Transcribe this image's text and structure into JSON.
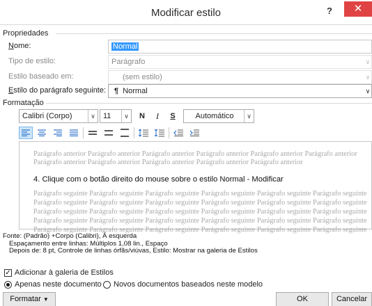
{
  "window": {
    "title": "Modificar estilo",
    "help_label": "?",
    "close_label": "✕"
  },
  "properties": {
    "section_label": "Propriedades",
    "name_label": "Nome:",
    "name_value": "Normal",
    "style_type_label": "Tipo de estilo:",
    "style_type_value": "Parágrafo",
    "based_on_label": "Estilo baseado em:",
    "based_on_value": "(sem estilo)",
    "next_style_label": "Estilo do parágrafo seguinte:",
    "next_style_value": "Normal",
    "pilcrow": "¶"
  },
  "formatting": {
    "section_label": "Formatação",
    "font_name": "Calibri (Corpo)",
    "font_size": "11",
    "bold_label": "N",
    "italic_label": "I",
    "underline_label": "S",
    "color_value": "Automático",
    "accent_color": "#2a6fc9"
  },
  "preview": {
    "previous_paragraph": "Parágrafo anterior Parágrafo anterior Parágrafo anterior Parágrafo anterior Parágrafo anterior Parágrafo anterior Parágrafo anterior Parágrafo anterior Parágrafo anterior Parágrafo anterior Parágrafo anterior",
    "sample_text": "4. Clique com o botão direito do mouse sobre o estilo Normal - Modificar",
    "following_lines": [
      "Parágrafo seguinte Parágrafo seguinte Parágrafo seguinte Parágrafo seguinte Parágrafo seguinte Parágrafo seguinte",
      "Parágrafo seguinte Parágrafo seguinte Parágrafo seguinte Parágrafo seguinte Parágrafo seguinte Parágrafo seguinte",
      "Parágrafo seguinte Parágrafo seguinte Parágrafo seguinte Parágrafo seguinte Parágrafo seguinte Parágrafo seguinte",
      "Parágrafo seguinte Parágrafo seguinte Parágrafo seguinte Parágrafo seguinte Parágrafo seguinte Parágrafo seguinte",
      "Parágrafo seguinte Parágrafo seguinte Parágrafo seguinte Parágrafo seguinte Parágrafo seguinte Parágrafo seguinte"
    ]
  },
  "description": {
    "line1": "Fonte: (Padrão) +Corpo (Calibri), À esquerda",
    "line2": "Espaçamento entre linhas:  Múltiplos 1,08 lin., Espaço",
    "line3": "Depois de:  8 pt, Controle de linhas órfãs/viúvas, Estilo: Mostrar na galeria de Estilos"
  },
  "options": {
    "add_to_gallery_label": "Adicionar à galeria de Estilos",
    "add_to_gallery_checked": true,
    "only_this_document_label": "Apenas neste documento",
    "new_documents_label": "Novos documentos baseados neste modelo"
  },
  "buttons": {
    "format_label": "Formatar",
    "ok_label": "OK",
    "cancel_label": "Cancelar"
  }
}
